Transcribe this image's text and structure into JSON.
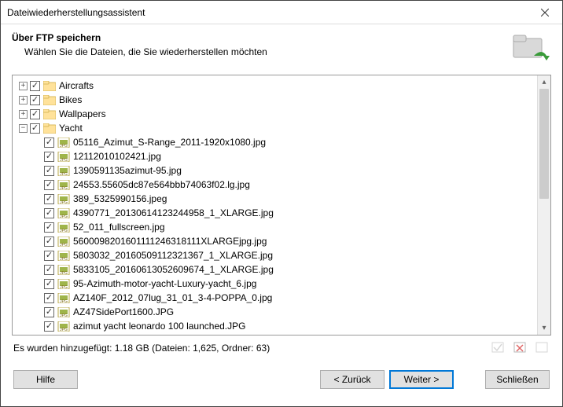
{
  "window": {
    "title": "Dateiwiederherstellungsassistent"
  },
  "header": {
    "title": "Über FTP speichern",
    "subtitle": "Wählen Sie die Dateien, die Sie wiederherstellen möchten"
  },
  "folders": [
    {
      "name": "Aircrafts",
      "expanded": false,
      "checked": true
    },
    {
      "name": "Bikes",
      "expanded": false,
      "checked": true
    },
    {
      "name": "Wallpapers",
      "expanded": false,
      "checked": true
    },
    {
      "name": "Yacht",
      "expanded": true,
      "checked": true
    }
  ],
  "files": [
    {
      "name": "05116_Azimut_S-Range_2011-1920x1080.jpg",
      "checked": true
    },
    {
      "name": "12112010102421.jpg",
      "checked": true
    },
    {
      "name": "1390591135azimut-95.jpg",
      "checked": true
    },
    {
      "name": "24553.55605dc87e564bbb74063f02.lg.jpg",
      "checked": true
    },
    {
      "name": "389_5325990156.jpeg",
      "checked": true
    },
    {
      "name": "4390771_20130614123244958_1_XLARGE.jpg",
      "checked": true
    },
    {
      "name": "52_011_fullscreen.jpg",
      "checked": true
    },
    {
      "name": "5600098201601111246318111XLARGEjpg.jpg",
      "checked": true
    },
    {
      "name": "5803032_20160509112321367_1_XLARGE.jpg",
      "checked": true
    },
    {
      "name": "5833105_20160613052609674_1_XLARGE.jpg",
      "checked": true
    },
    {
      "name": "95-Azimuth-motor-yacht-Luxury-yacht_6.jpg",
      "checked": true
    },
    {
      "name": "AZ140F_2012_07lug_31_01_3-4-POPPA_0.jpg",
      "checked": true
    },
    {
      "name": "AZ47SidePort1600.JPG",
      "checked": true
    },
    {
      "name": "azimut yacht leonardo 100 launched.JPG",
      "checked": true
    }
  ],
  "status": {
    "text": "Es wurden hinzugefügt: 1.18 GB (Dateien: 1,625, Ordner: 63)"
  },
  "buttons": {
    "help": "Hilfe",
    "back": "< Zurück",
    "next": "Weiter >",
    "close": "Schließen"
  }
}
